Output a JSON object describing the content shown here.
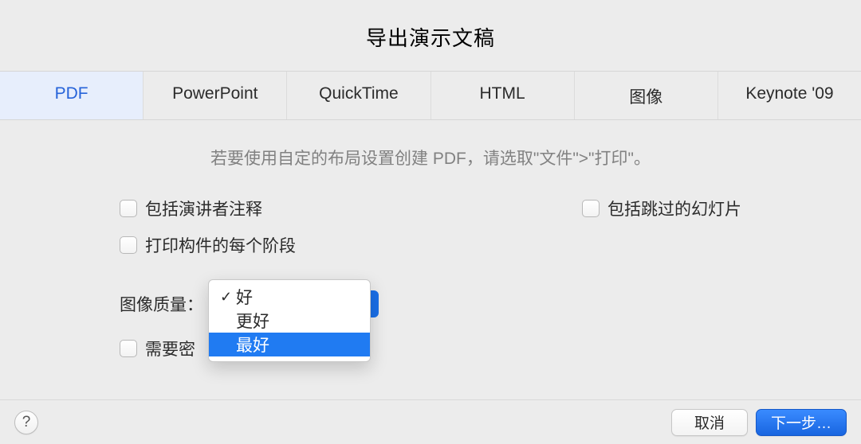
{
  "window": {
    "title": "导出演示文稿"
  },
  "tabs": [
    {
      "label": "PDF",
      "active": true
    },
    {
      "label": "PowerPoint",
      "active": false
    },
    {
      "label": "QuickTime",
      "active": false
    },
    {
      "label": "HTML",
      "active": false
    },
    {
      "label": "图像",
      "active": false
    },
    {
      "label": "Keynote '09",
      "active": false
    }
  ],
  "instruction": "若要使用自定的布局设置创建 PDF，请选取\"文件\">\"打印\"。",
  "options": {
    "include_presenter_notes": "包括演讲者注释",
    "include_skipped_slides": "包括跳过的幻灯片",
    "print_each_stage": "打印构件的每个阶段",
    "require_password": "需要密"
  },
  "quality": {
    "label": "图像质量：",
    "selected": "好",
    "menu": [
      {
        "label": "好",
        "checked": true,
        "highlighted": false
      },
      {
        "label": "更好",
        "checked": false,
        "highlighted": false
      },
      {
        "label": "最好",
        "checked": false,
        "highlighted": true
      }
    ]
  },
  "footer": {
    "help": "?",
    "cancel": "取消",
    "next": "下一步…"
  }
}
